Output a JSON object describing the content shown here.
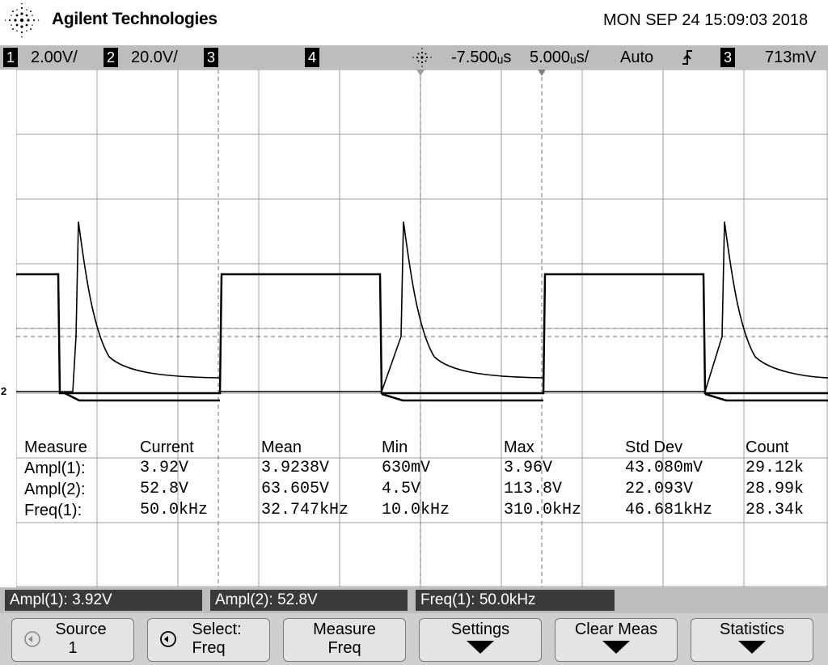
{
  "header": {
    "brand": "Agilent Technologies",
    "datetime": "MON SEP 24 15:09:03 2018"
  },
  "status_bar": {
    "ch1_num": "1",
    "ch1_scale": "2.00V/",
    "ch2_num": "2",
    "ch2_scale": "20.0V/",
    "ch3_num": "3",
    "ch4_num": "4",
    "time_delay": "-7.500ᵤs",
    "time_scale": "5.000ᵤs/",
    "trigger_mode": "Auto",
    "trigger_slope_icon": "rising-edge-icon",
    "trigger_source_num": "3",
    "trigger_level": "713mV"
  },
  "measurements": {
    "headers": [
      "Measure",
      "Current",
      "Mean",
      "Min",
      "Max",
      "Std Dev",
      "Count"
    ],
    "rows": [
      [
        "Ampl(1):",
        "3.92V",
        "3.9238V",
        "630mV",
        "3.96V",
        "43.080mV",
        "29.12k"
      ],
      [
        "Ampl(2):",
        "52.8V",
        "63.605V",
        "4.5V",
        "113.8V",
        "22.093V",
        "28.99k"
      ],
      [
        "Freq(1):",
        "50.0kHz",
        "32.747kHz",
        "10.0kHz",
        "310.0kHz",
        "46.681kHz",
        "28.34k"
      ]
    ]
  },
  "channel_marker": "2",
  "readouts": [
    "Ampl(1): 3.92V",
    "Ampl(2): 52.8V",
    "Freq(1): 50.0kHz"
  ],
  "softkeys": {
    "source": {
      "line1": "Source",
      "line2": "1"
    },
    "select": {
      "line1": "Select:",
      "line2": "Freq"
    },
    "measure": {
      "line1": "Measure",
      "line2": "Freq"
    },
    "settings": {
      "line1": "Settings"
    },
    "clear_meas": {
      "line1": "Clear Meas"
    },
    "statistics": {
      "line1": "Statistics"
    }
  },
  "colors": {
    "trace": "#000000",
    "grid": "#9e9e9e",
    "bar_gray": "#bdbdbd",
    "readout_bg": "#3a3a3a"
  }
}
